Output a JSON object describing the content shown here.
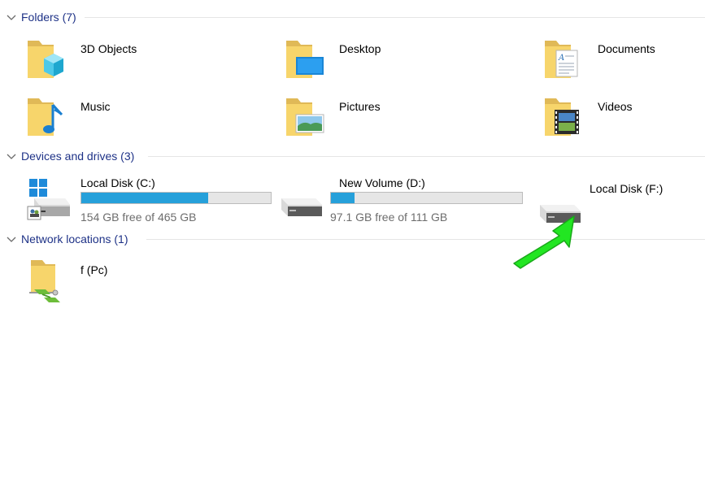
{
  "groups": {
    "folders": {
      "title": "Folders (7)"
    },
    "drives": {
      "title": "Devices and drives (3)"
    },
    "network": {
      "title": "Network locations (1)"
    }
  },
  "folders": [
    {
      "name": "3D Objects",
      "icon": "3d-objects-folder-icon"
    },
    {
      "name": "Desktop",
      "icon": "desktop-folder-icon"
    },
    {
      "name": "Documents",
      "icon": "documents-folder-icon"
    },
    {
      "name": "Music",
      "icon": "music-folder-icon"
    },
    {
      "name": "Pictures",
      "icon": "pictures-folder-icon"
    },
    {
      "name": "Videos",
      "icon": "videos-folder-icon"
    }
  ],
  "drives": [
    {
      "name": "Local Disk (C:)",
      "free": "154 GB free of 465 GB",
      "used_fraction": 0.669,
      "icon": "windows-system-drive-icon"
    },
    {
      "name": "New Volume (D:)",
      "free": "97.1 GB free of 111 GB",
      "used_fraction": 0.125,
      "icon": "hard-drive-icon"
    },
    {
      "name": "Local Disk (F:)",
      "icon": "hard-drive-icon"
    }
  ],
  "network": [
    {
      "name": "f (Pc)",
      "icon": "network-folder-icon"
    }
  ],
  "colors": {
    "group_title": "#1e3287",
    "progress_fill": "#26a0da",
    "progress_track": "#e6e6e6",
    "secondary_text": "#6d6d6d",
    "pointer_arrow": "#22e622"
  }
}
